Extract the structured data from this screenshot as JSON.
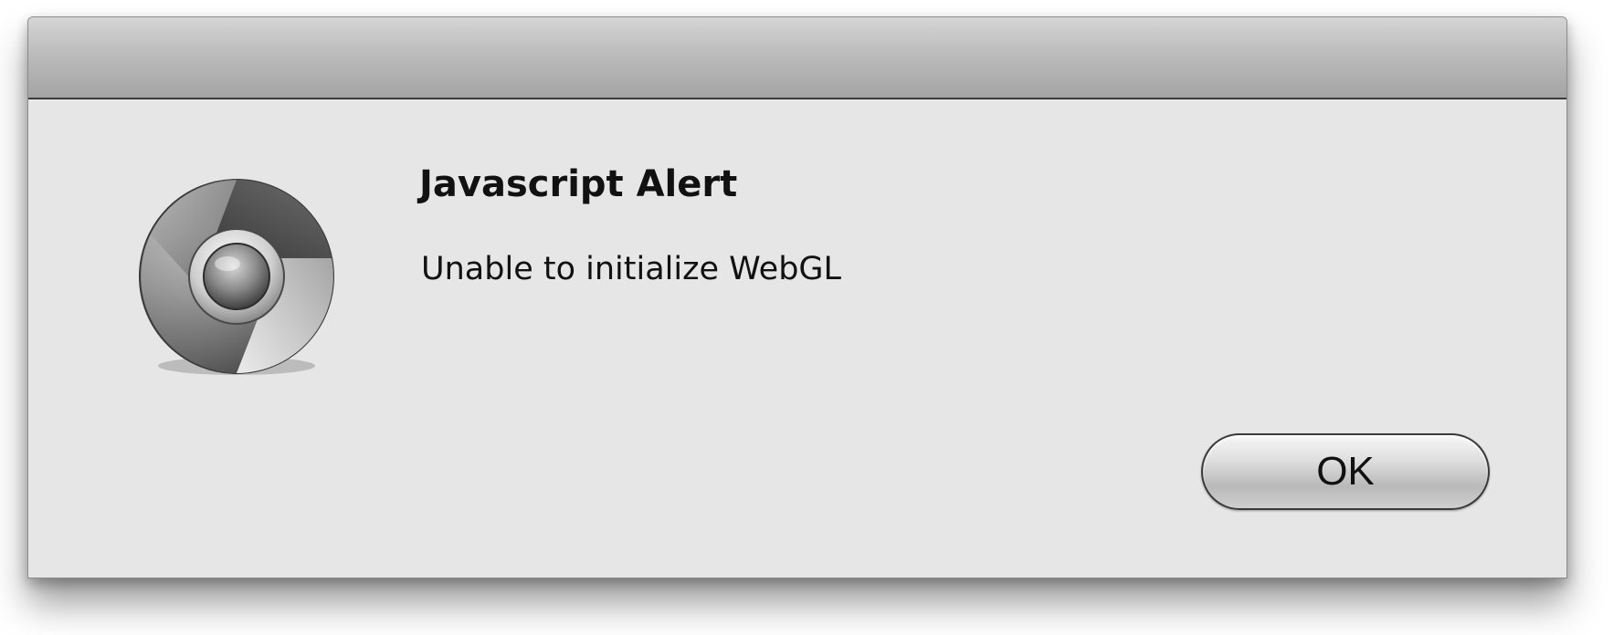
{
  "dialog": {
    "title": "Javascript Alert",
    "message": "Unable to initialize WebGL",
    "icon": "chrome-browser-icon",
    "buttons": {
      "ok_label": "OK"
    }
  },
  "colors": {
    "dialog_background": "#e6e6e6",
    "titlebar_top": "#d5d5d5",
    "titlebar_bottom": "#a4a4a4",
    "text": "#111111"
  }
}
